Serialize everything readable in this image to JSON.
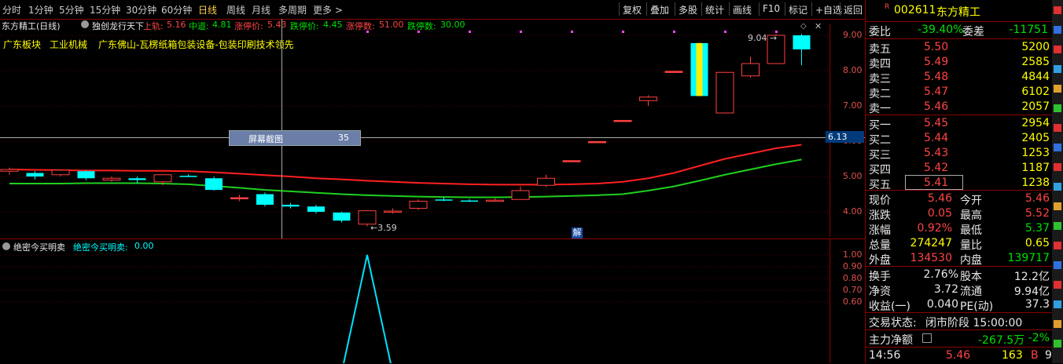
{
  "toolbar": {
    "periods": [
      "分时",
      "1分钟",
      "5分钟",
      "15分钟",
      "30分钟",
      "60分钟",
      "日线",
      "周线",
      "月线",
      "多周期",
      "更多 >"
    ],
    "active": "日线",
    "tools": [
      "复权",
      "叠加",
      "多股",
      "统计",
      "画线",
      "F10",
      "标记",
      "+自选",
      "返回"
    ]
  },
  "header": {
    "title": "东方精工(日线)",
    "indicator": "独创龙行天下",
    "upper_label": "上轨:",
    "upper": "5.16",
    "mid_label": "中道:",
    "mid": "4.81",
    "limit_up_label": "涨停价:",
    "limit_up": "5.43",
    "limit_down_label": "跌停价:",
    "limit_down": "4.45",
    "up_count_label": "涨停数:",
    "up_count": "51.00",
    "down_count_label": "跌停数:",
    "down_count": "30.00"
  },
  "tags": [
    "广东板块",
    "工业机械",
    "广东佛山-瓦楞纸箱包装设备-包装印刷技术领先"
  ],
  "price_axis": [
    "9.00",
    "8.00",
    "7.00",
    "6.00",
    "5.00",
    "4.00"
  ],
  "crosshair_price": "6.13",
  "tooltip": {
    "label": "屏幕截图",
    "value": "35"
  },
  "annotations": {
    "high": "9.04",
    "low": "3.59",
    "marker": "解"
  },
  "lower": {
    "title": "绝密今买明卖",
    "series_label": "绝密今买明卖:",
    "value": "0.00",
    "axis": [
      "1.00",
      "0.90",
      "0.80",
      "0.70",
      "0.60"
    ]
  },
  "chart_data": {
    "type": "candlestick",
    "ohlc": [
      {
        "o": 5.15,
        "h": 5.25,
        "l": 5.05,
        "c": 5.2
      },
      {
        "o": 5.1,
        "h": 5.15,
        "l": 4.92,
        "c": 5.0
      },
      {
        "o": 5.05,
        "h": 5.2,
        "l": 5.0,
        "c": 5.18
      },
      {
        "o": 5.15,
        "h": 5.18,
        "l": 4.9,
        "c": 4.95
      },
      {
        "o": 4.9,
        "h": 5.0,
        "l": 4.85,
        "c": 4.95
      },
      {
        "o": 4.95,
        "h": 5.0,
        "l": 4.8,
        "c": 4.9
      },
      {
        "o": 4.85,
        "h": 5.05,
        "l": 4.75,
        "c": 5.05
      },
      {
        "o": 5.02,
        "h": 5.06,
        "l": 4.98,
        "c": 5.0
      },
      {
        "o": 4.95,
        "h": 5.0,
        "l": 4.6,
        "c": 4.62
      },
      {
        "o": 4.4,
        "h": 4.48,
        "l": 4.3,
        "c": 4.4
      },
      {
        "o": 4.5,
        "h": 4.55,
        "l": 4.15,
        "c": 4.2
      },
      {
        "o": 4.2,
        "h": 4.25,
        "l": 4.1,
        "c": 4.15
      },
      {
        "o": 4.15,
        "h": 4.2,
        "l": 3.95,
        "c": 4.0
      },
      {
        "o": 3.98,
        "h": 4.0,
        "l": 3.7,
        "c": 3.75
      },
      {
        "o": 3.65,
        "h": 4.05,
        "l": 3.59,
        "c": 4.03
      },
      {
        "o": 4.0,
        "h": 4.1,
        "l": 3.95,
        "c": 4.02
      },
      {
        "o": 4.1,
        "h": 4.35,
        "l": 4.05,
        "c": 4.3
      },
      {
        "o": 4.35,
        "h": 4.42,
        "l": 4.3,
        "c": 4.32
      },
      {
        "o": 4.32,
        "h": 4.36,
        "l": 4.28,
        "c": 4.3
      },
      {
        "o": 4.3,
        "h": 4.38,
        "l": 4.28,
        "c": 4.33
      },
      {
        "o": 4.35,
        "h": 4.72,
        "l": 4.35,
        "c": 4.6
      },
      {
        "o": 4.75,
        "h": 5.05,
        "l": 4.7,
        "c": 4.95
      },
      {
        "o": 5.45,
        "h": 5.45,
        "l": 5.45,
        "c": 5.45
      },
      {
        "o": 5.99,
        "h": 5.99,
        "l": 5.99,
        "c": 5.99
      },
      {
        "o": 6.59,
        "h": 6.59,
        "l": 6.59,
        "c": 6.59
      },
      {
        "o": 7.15,
        "h": 7.3,
        "l": 7.0,
        "c": 7.25
      },
      {
        "o": 7.98,
        "h": 7.98,
        "l": 7.98,
        "c": 7.98
      },
      {
        "o": 8.78,
        "h": 8.78,
        "l": 7.28,
        "c": 7.28
      },
      {
        "o": 6.8,
        "h": 7.95,
        "l": 6.8,
        "c": 7.95
      },
      {
        "o": 7.85,
        "h": 8.4,
        "l": 7.8,
        "c": 8.2
      },
      {
        "o": 8.2,
        "h": 9.04,
        "l": 8.2,
        "c": 9.0
      },
      {
        "o": 9.0,
        "h": 9.04,
        "l": 8.15,
        "c": 8.6
      }
    ],
    "upper_band": [
      5.2,
      5.19,
      5.18,
      5.17,
      5.17,
      5.16,
      5.16,
      5.15,
      5.12,
      5.08,
      5.04,
      5.0,
      4.95,
      4.92,
      4.88,
      4.85,
      4.82,
      4.8,
      4.78,
      4.77,
      4.77,
      4.77,
      4.78,
      4.8,
      4.85,
      4.95,
      5.1,
      5.3,
      5.5,
      5.65,
      5.8,
      5.9
    ],
    "mid_band": [
      4.8,
      4.8,
      4.8,
      4.81,
      4.81,
      4.81,
      4.8,
      4.78,
      4.73,
      4.68,
      4.62,
      4.58,
      4.54,
      4.5,
      4.47,
      4.45,
      4.43,
      4.42,
      4.41,
      4.41,
      4.42,
      4.43,
      4.45,
      4.47,
      4.5,
      4.6,
      4.72,
      4.88,
      5.05,
      5.2,
      5.35,
      5.48
    ],
    "lower_series": [
      0,
      0,
      0,
      0,
      0,
      0,
      0,
      0,
      0,
      0,
      0,
      0,
      0,
      0,
      1,
      0,
      0,
      0,
      0,
      0,
      0,
      0,
      0,
      0,
      0,
      0,
      0,
      0,
      0,
      0,
      0,
      0
    ],
    "ylim": [
      3.3,
      9.3
    ]
  },
  "quote": {
    "code": "002611",
    "name": "东方精工",
    "weibi_label": "委比",
    "weibi": "-39.40%",
    "weicha_label": "委差",
    "weicha": "-11751",
    "asks": [
      {
        "label": "卖五",
        "price": "5.50",
        "vol": "5200"
      },
      {
        "label": "卖四",
        "price": "5.49",
        "vol": "2585"
      },
      {
        "label": "卖三",
        "price": "5.48",
        "vol": "4844"
      },
      {
        "label": "卖二",
        "price": "5.47",
        "vol": "6102"
      },
      {
        "label": "卖一",
        "price": "5.46",
        "vol": "2057"
      }
    ],
    "bids": [
      {
        "label": "买一",
        "price": "5.45",
        "vol": "2954"
      },
      {
        "label": "买二",
        "price": "5.44",
        "vol": "2405"
      },
      {
        "label": "买三",
        "price": "5.43",
        "vol": "1253"
      },
      {
        "label": "买四",
        "price": "5.42",
        "vol": "1187"
      },
      {
        "label": "买五",
        "price": "5.41",
        "vol": "1238"
      }
    ],
    "stats1": [
      [
        "现价",
        "5.46",
        "今开",
        "5.46"
      ],
      [
        "涨跌",
        "0.05",
        "最高",
        "5.52"
      ],
      [
        "涨幅",
        "0.92%",
        "最低",
        "5.37"
      ],
      [
        "总量",
        "274247",
        "量比",
        "0.65"
      ],
      [
        "外盘",
        "134530",
        "内盘",
        "139717"
      ]
    ],
    "stats2": [
      [
        "换手",
        "2.76%",
        "股本",
        "12.2亿"
      ],
      [
        "净资",
        "3.72",
        "流通",
        "9.94亿"
      ],
      [
        "收益(一)",
        "0.040",
        "PE(动)",
        "37.3"
      ]
    ],
    "status_label": "交易状态:",
    "status": "闭市阶段 15:00:00",
    "flow_label": "主力净额",
    "flow": "-267.5万",
    "flow_pct": "-2%",
    "tick_time": "14:56",
    "tick_price": "5.46",
    "tick_vol": "163",
    "tick_side": "B",
    "tick_n": "9"
  }
}
